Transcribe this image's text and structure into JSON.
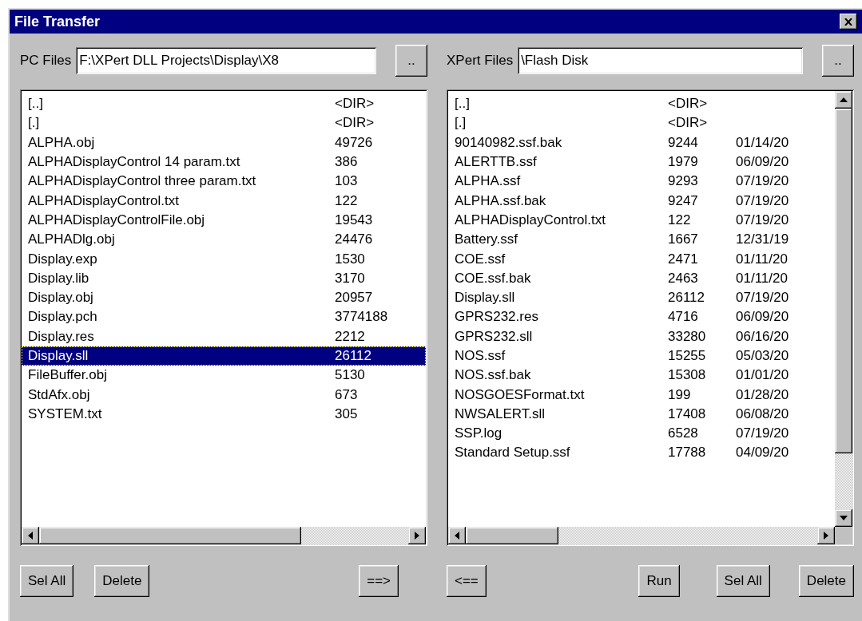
{
  "window": {
    "title": "File Transfer"
  },
  "pc_panel": {
    "label": "PC Files",
    "path": "F:\\XPert DLL Projects\\Display\\X8",
    "browse": "..",
    "files": [
      {
        "name": "[..]",
        "size": "<DIR>",
        "selected": false
      },
      {
        "name": "[.]",
        "size": "<DIR>",
        "selected": false
      },
      {
        "name": "ALPHA.obj",
        "size": "49726",
        "selected": false
      },
      {
        "name": "ALPHADisplayControl 14 param.txt",
        "size": "386",
        "selected": false
      },
      {
        "name": "ALPHADisplayControl three param.txt",
        "size": "103",
        "selected": false
      },
      {
        "name": "ALPHADisplayControl.txt",
        "size": "122",
        "selected": false
      },
      {
        "name": "ALPHADisplayControlFile.obj",
        "size": "19543",
        "selected": false
      },
      {
        "name": "ALPHADlg.obj",
        "size": "24476",
        "selected": false
      },
      {
        "name": "Display.exp",
        "size": "1530",
        "selected": false
      },
      {
        "name": "Display.lib",
        "size": "3170",
        "selected": false
      },
      {
        "name": "Display.obj",
        "size": "20957",
        "selected": false
      },
      {
        "name": "Display.pch",
        "size": "3774188",
        "selected": false
      },
      {
        "name": "Display.res",
        "size": "2212",
        "selected": false
      },
      {
        "name": "Display.sll",
        "size": "26112",
        "selected": true
      },
      {
        "name": "FileBuffer.obj",
        "size": "5130",
        "selected": false
      },
      {
        "name": "StdAfx.obj",
        "size": "673",
        "selected": false
      },
      {
        "name": "SYSTEM.txt",
        "size": "305",
        "selected": false
      }
    ],
    "actions": [
      {
        "label": "Sel All"
      },
      {
        "label": "Delete"
      },
      {
        "label": "==>"
      }
    ]
  },
  "xpert_panel": {
    "label": "XPert Files",
    "path": "\\Flash Disk",
    "browse": "..",
    "files": [
      {
        "name": "[..]",
        "size": "<DIR>",
        "selected": false
      },
      {
        "name": "[.]",
        "size": "<DIR>",
        "selected": false
      },
      {
        "name": "90140982.ssf.bak",
        "size": "9244",
        "date": "01/14/20",
        "selected": false
      },
      {
        "name": "ALERTTB.ssf",
        "size": "1979",
        "date": "06/09/20",
        "selected": false
      },
      {
        "name": "ALPHA.ssf",
        "size": "9293",
        "date": "07/19/20",
        "selected": false
      },
      {
        "name": "ALPHA.ssf.bak",
        "size": "9247",
        "date": "07/19/20",
        "selected": false
      },
      {
        "name": "ALPHADisplayControl.txt",
        "size": "122",
        "date": "07/19/20",
        "selected": false
      },
      {
        "name": "Battery.ssf",
        "size": "1667",
        "date": "12/31/19",
        "selected": false
      },
      {
        "name": "COE.ssf",
        "size": "2471",
        "date": "01/11/20",
        "selected": false
      },
      {
        "name": "COE.ssf.bak",
        "size": "2463",
        "date": "01/11/20",
        "selected": false
      },
      {
        "name": "Display.sll",
        "size": "26112",
        "date": "07/19/20",
        "selected": false
      },
      {
        "name": "GPRS232.res",
        "size": "4716",
        "date": "06/09/20",
        "selected": false
      },
      {
        "name": "GPRS232.sll",
        "size": "33280",
        "date": "06/16/20",
        "selected": false
      },
      {
        "name": "NOS.ssf",
        "size": "15255",
        "date": "05/03/20",
        "selected": false
      },
      {
        "name": "NOS.ssf.bak",
        "size": "15308",
        "date": "01/01/20",
        "selected": false
      },
      {
        "name": "NOSGOESFormat.txt",
        "size": "199",
        "date": "01/28/20",
        "selected": false
      },
      {
        "name": "NWSALERT.sll",
        "size": "17408",
        "date": "06/08/20",
        "selected": false
      },
      {
        "name": "SSP.log",
        "size": "6528",
        "date": "07/19/20",
        "selected": false
      },
      {
        "name": "Standard Setup.ssf",
        "size": "17788",
        "date": "04/09/20",
        "selected": false
      }
    ],
    "actions": [
      {
        "label": "<=="
      },
      {
        "label": "Run"
      },
      {
        "label": "Sel All"
      },
      {
        "label": "Delete"
      }
    ]
  }
}
